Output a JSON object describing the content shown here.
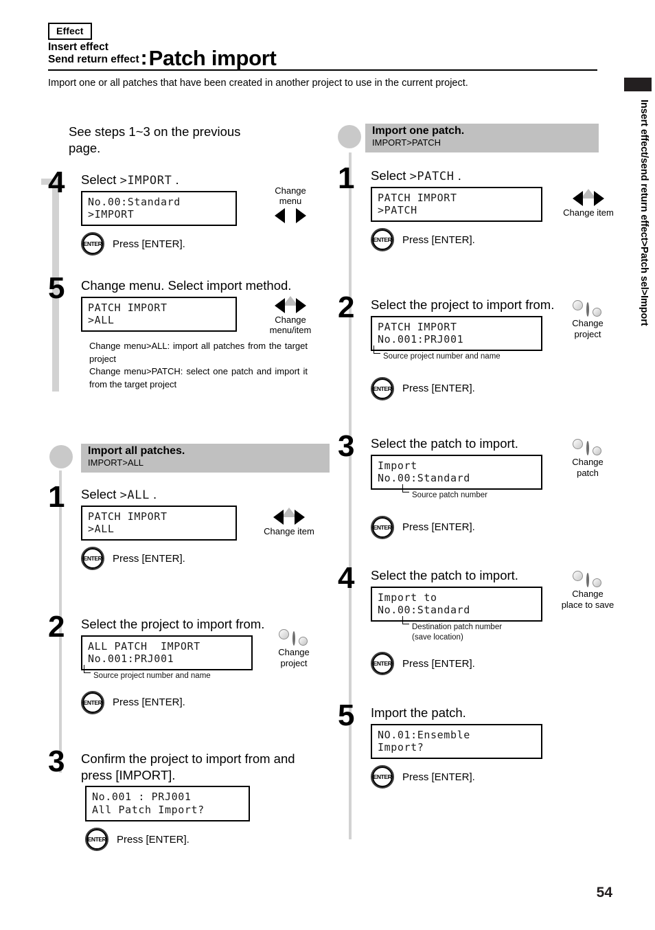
{
  "header": {
    "effect_tag": "Effect",
    "title_line1": "Insert effect",
    "title_line2": "Send return effect",
    "colon": ":",
    "title_main": "Patch import",
    "intro": "Import one or all patches that have been created in another project to use in the current project."
  },
  "side_tab": {
    "text": "Insert effect/send return effect>Patch sel>Import"
  },
  "page_number": "54",
  "left_column": {
    "lead_note": "See steps 1~3 on the previous page.",
    "step4": {
      "number": "4",
      "head_prefix": "Select ",
      "head_lcd": ">IMPORT",
      "head_suffix": " .",
      "lcd": [
        "No.00:Standard",
        ">IMPORT"
      ],
      "arrows_label": "Change\nmenu",
      "enter_text": "Press [ENTER]."
    },
    "step5": {
      "number": "5",
      "head": "Change menu. Select import method.",
      "lcd": [
        "PATCH IMPORT",
        ">ALL"
      ],
      "arrows_label": "Change\nmenu/item",
      "explain_1": "Change menu>ALL: import all patches from the target project",
      "explain_2": "Change menu>PATCH: select one patch and import it from the target project"
    },
    "section": {
      "title": "Import all patches.",
      "subtitle": "IMPORT>ALL"
    },
    "step1": {
      "number": "1",
      "head_prefix": "Select ",
      "head_lcd": ">ALL",
      "head_suffix": " .",
      "lcd": [
        "PATCH IMPORT",
        ">ALL"
      ],
      "arrows_label": "Change item",
      "enter_text": "Press [ENTER]."
    },
    "step2": {
      "number": "2",
      "head": "Select the project to import from.",
      "lcd": [
        "ALL PATCH  IMPORT",
        "No.001:PRJ001"
      ],
      "callout": "Source project number and name",
      "knob_label": "Change\nproject",
      "enter_text": "Press [ENTER]."
    },
    "step3": {
      "number": "3",
      "head": "Confirm the project to import from and press [IMPORT].",
      "lcd": [
        "No.001 : PRJ001",
        "All Patch Import?"
      ],
      "enter_text": "Press [ENTER]."
    }
  },
  "right_column": {
    "section": {
      "title": "Import one patch.",
      "subtitle": "IMPORT>PATCH"
    },
    "step1": {
      "number": "1",
      "head_prefix": "Select ",
      "head_lcd": ">PATCH",
      "head_suffix": " .",
      "lcd": [
        "PATCH IMPORT",
        ">PATCH"
      ],
      "arrows_label": "Change item",
      "enter_text": "Press [ENTER]."
    },
    "step2": {
      "number": "2",
      "head": "Select the project to import from.",
      "lcd": [
        "PATCH IMPORT",
        "No.001:PRJ001"
      ],
      "callout": "Source project number and name",
      "knob_label": "Change\nproject",
      "enter_text": "Press [ENTER]."
    },
    "step3": {
      "number": "3",
      "head": "Select the patch to import.",
      "lcd": [
        "Import",
        "No.00:Standard"
      ],
      "callout": "Source patch number",
      "knob_label": "Change\npatch",
      "enter_text": "Press [ENTER]."
    },
    "step4": {
      "number": "4",
      "head": "Select the patch to import.",
      "lcd": [
        "Import to",
        "No.00:Standard"
      ],
      "callout": "Destination patch  number",
      "callout2": "(save location)",
      "knob_label": "Change\nplace to save",
      "enter_text": "Press [ENTER]."
    },
    "step5": {
      "number": "5",
      "head": "Import the patch.",
      "lcd": [
        "NO.01:Ensemble",
        "Import?"
      ],
      "enter_text": "Press [ENTER]."
    }
  },
  "icons": {
    "enter_label": "ENTER"
  },
  "colors": {
    "band": "#c0c0c0",
    "rail": "#d2d2d2",
    "side_block": "#231f20",
    "gray_triangle": "#bcbcbc"
  }
}
